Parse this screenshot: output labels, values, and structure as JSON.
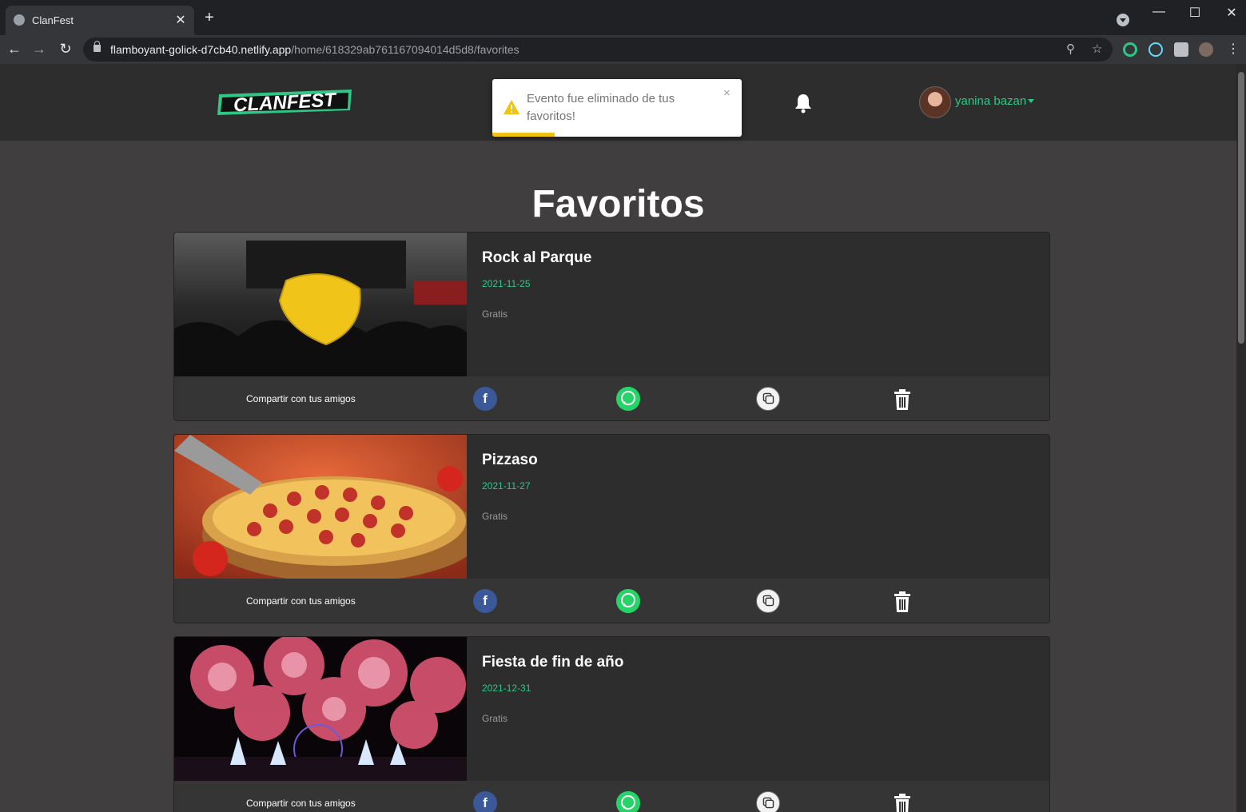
{
  "browser": {
    "tab_title": "ClanFest",
    "tab_close": "✕",
    "new_tab": "+",
    "url_host": "flamboyant-golick-d7cb40.netlify.app",
    "url_path": "/home/618329ab761167094014d5d8/favorites",
    "window": {
      "minimize": "—",
      "maximize": "☐",
      "close": "✕"
    },
    "nav": {
      "back": "←",
      "forward": "→",
      "reload": "↻"
    },
    "omnibox_icons": {
      "location": "⚲",
      "bookmark": "☆"
    }
  },
  "navbar": {
    "logo_text": "CLANFEST",
    "user_name": "yanina bazan",
    "logo_colors": {
      "stripe": "#2ec785",
      "text": "#ffffff"
    }
  },
  "toast": {
    "message": "Evento fue eliminado de tus favoritos!",
    "close": "×",
    "progress": 0.25,
    "accent": "#f1c40f"
  },
  "page": {
    "heading": "Favoritos"
  },
  "favorites": [
    {
      "title": "Rock al Parque",
      "date": "2021-11-25",
      "price": "Gratis",
      "share_label": "Compartir con tus amigos",
      "image": "rock-al-parque-concert"
    },
    {
      "title": "Pizzaso",
      "date": "2021-11-27",
      "price": "Gratis",
      "share_label": "Compartir con tus amigos",
      "image": "pepperoni-pizza"
    },
    {
      "title": "Fiesta de fin de año",
      "date": "2021-12-31",
      "price": "Gratis",
      "share_label": "Compartir con tus amigos",
      "image": "fireworks"
    }
  ],
  "share": {
    "facebook": "f"
  },
  "colors": {
    "accent": "#2ec785",
    "background": "#403e3f",
    "card": "#2e2d2e"
  }
}
